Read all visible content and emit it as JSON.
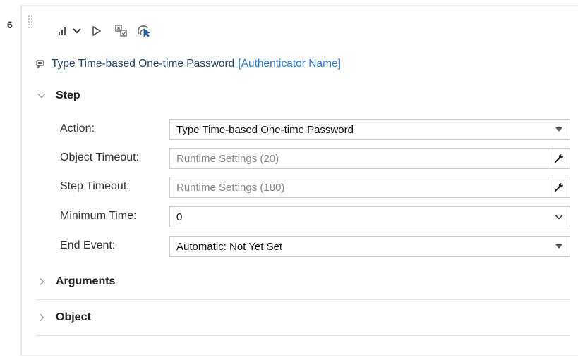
{
  "step": {
    "number": "6",
    "toolbar": {
      "icons": [
        "bar-chart-icon",
        "chevron-down-icon",
        "play-icon",
        "checkbox-list-icon",
        "cursor-target-icon"
      ]
    },
    "title": {
      "action": "Type Time-based One-time Password",
      "target": "[Authenticator Name]"
    }
  },
  "sections": {
    "step": {
      "label": "Step",
      "fields": {
        "action": {
          "label": "Action:",
          "value": "Type Time-based One-time Password"
        },
        "object_timeout": {
          "label": "Object Timeout:",
          "placeholder": "Runtime Settings (20)"
        },
        "step_timeout": {
          "label": "Step Timeout:",
          "placeholder": "Runtime Settings (180)"
        },
        "minimum_time": {
          "label": "Minimum Time:",
          "value": "0"
        },
        "end_event": {
          "label": "End Event:",
          "value": "Automatic: Not Yet Set"
        }
      }
    },
    "arguments": {
      "label": "Arguments"
    },
    "object": {
      "label": "Object"
    }
  },
  "colors": {
    "link": "#2d7ad6",
    "title_action": "#24466f",
    "border": "#cfcfcf",
    "placeholder": "#888888"
  }
}
